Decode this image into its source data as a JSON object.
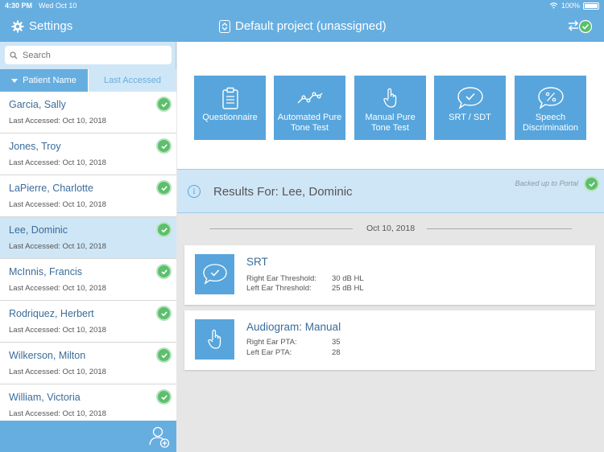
{
  "status_bar": {
    "time": "4:30 PM",
    "date": "Wed Oct 10",
    "battery": "100%"
  },
  "nav": {
    "settings_label": "Settings",
    "project_label": "Default project (unassigned)"
  },
  "sidebar": {
    "search_placeholder": "Search",
    "sort_tabs": {
      "active": "Patient Name",
      "inactive": "Last Accessed"
    },
    "patients": [
      {
        "name": "Garcia, Sally",
        "accessed": "Last Accessed: Oct 10, 2018"
      },
      {
        "name": "Jones, Troy",
        "accessed": "Last Accessed: Oct 10, 2018"
      },
      {
        "name": "LaPierre, Charlotte",
        "accessed": "Last Accessed: Oct 10, 2018"
      },
      {
        "name": "Lee, Dominic",
        "accessed": "Last Accessed: Oct 10, 2018"
      },
      {
        "name": "McInnis, Francis",
        "accessed": "Last Accessed: Oct 10, 2018"
      },
      {
        "name": "Rodriquez, Herbert",
        "accessed": "Last Accessed: Oct 10, 2018"
      },
      {
        "name": "Wilkerson, Milton",
        "accessed": "Last Accessed: Oct 10, 2018"
      },
      {
        "name": "William, Victoria",
        "accessed": "Last Accessed: Oct 10, 2018"
      }
    ]
  },
  "tests": [
    {
      "label": "Questionnaire",
      "icon": "clipboard-icon"
    },
    {
      "label": "Automated Pure Tone Test",
      "icon": "waveform-icon"
    },
    {
      "label": "Manual Pure Tone Test",
      "icon": "hand-pointer-icon"
    },
    {
      "label": "SRT / SDT",
      "icon": "speech-check-icon"
    },
    {
      "label": "Speech Discrimination",
      "icon": "speech-percent-icon"
    }
  ],
  "results": {
    "title": "Results For: Lee, Dominic",
    "backup_text": "Backed up to Portal",
    "date": "Oct 10, 2018",
    "cards": [
      {
        "title": "SRT",
        "rows": [
          {
            "label": "Right Ear Threshold:",
            "value": "30 dB HL"
          },
          {
            "label": "Left Ear Threshold:",
            "value": "25 dB HL"
          }
        ]
      },
      {
        "title": "Audiogram: Manual",
        "rows": [
          {
            "label": "Right Ear PTA:",
            "value": "35"
          },
          {
            "label": "Left Ear PTA:",
            "value": "28"
          }
        ]
      }
    ]
  },
  "colors": {
    "primary": "#67aee0",
    "tile": "#57a5dc",
    "light": "#cfe6f6",
    "success": "#5cbf6c"
  }
}
